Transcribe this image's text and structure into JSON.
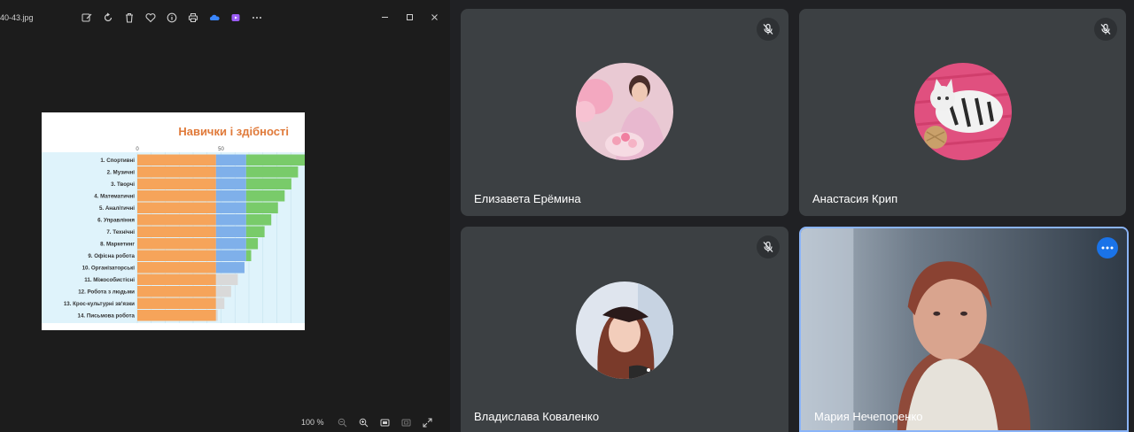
{
  "viewer": {
    "file_name": "40-43.jpg",
    "zoom": "100 %",
    "toolbar_icons": [
      "edit-icon",
      "rotate-icon",
      "delete-icon",
      "favorite-icon",
      "info-icon",
      "print-icon",
      "onedrive-icon",
      "clipchamp-icon",
      "more-icon"
    ],
    "window_controls": [
      "minimize-icon",
      "maximize-icon",
      "close-icon"
    ]
  },
  "slide": {
    "title": "Навички і здібності"
  },
  "chart_data": {
    "type": "bar",
    "orientation": "horizontal",
    "title": "Навички і здібності",
    "tick_labels": [
      "0",
      "50"
    ],
    "categories": [
      "1. Спортивні",
      "2. Музичні",
      "3. Творчі",
      "4. Математичні",
      "5. Аналітичні",
      "6. Управління",
      "7. Технічні",
      "8. Маркетинг",
      "9. Офісна робота",
      "10. Організаторські",
      "11. Міжособистісні",
      "12. Робота з людьми",
      "13. Крос-культурні зв'язки",
      "14. Письмова робота"
    ],
    "values": [
      100,
      96,
      92,
      88,
      84,
      80,
      76,
      72,
      68,
      64,
      60,
      56,
      52,
      48
    ],
    "xlim": [
      0,
      100
    ],
    "colors": {
      "orange": "#f6a45a",
      "blue": "#7fb0ea",
      "green": "#79cb6a",
      "grey": "#d9d9d9",
      "background": "#dff3fb"
    }
  },
  "meeting": {
    "participants": [
      {
        "name": "Елизавета Ерёмина",
        "muted": true
      },
      {
        "name": "Анастасия Крип",
        "muted": true
      },
      {
        "name": "Владислава Коваленко",
        "muted": true
      },
      {
        "name": "Мария Нечепоренко",
        "muted": false,
        "active": true
      }
    ],
    "accent": "#1a73e8"
  }
}
